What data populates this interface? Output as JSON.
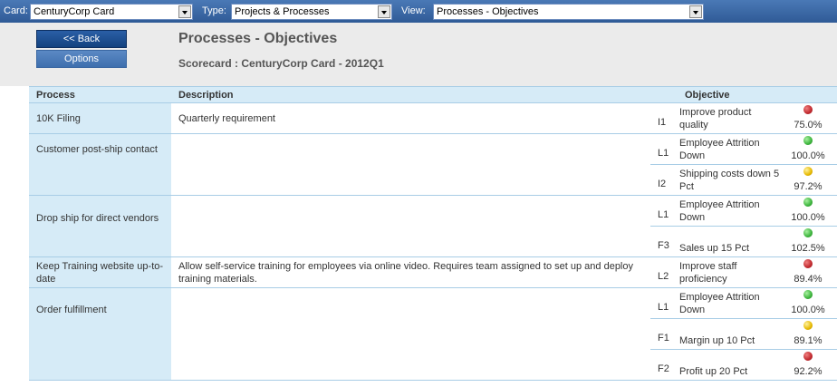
{
  "toolbar": {
    "card_label": "Card:",
    "card_value": "CenturyCorp Card",
    "type_label": "Type:",
    "type_value": "Projects & Processes",
    "view_label": "View:",
    "view_value": "Processes - Objectives"
  },
  "header": {
    "back_label": "<< Back",
    "options_label": "Options",
    "title": "Processes - Objectives",
    "subtitle": "Scorecard : CenturyCorp Card - 2012Q1"
  },
  "table": {
    "columns": {
      "process": "Process",
      "description": "Description",
      "objective": "Objective"
    },
    "rows": [
      {
        "process": "10K Filing",
        "description": "Quarterly requirement",
        "objectives": [
          {
            "code": "I1",
            "name": "Improve product quality",
            "status": "red",
            "value": "75.0%"
          }
        ]
      },
      {
        "process": "Customer post-ship contact",
        "description": "",
        "objectives": [
          {
            "code": "L1",
            "name": "Employee Attrition Down",
            "status": "green",
            "value": "100.0%"
          },
          {
            "code": "I2",
            "name": "Shipping costs down 5 Pct",
            "status": "yellow",
            "value": "97.2%"
          }
        ]
      },
      {
        "process": "Drop ship for direct vendors",
        "description": "",
        "objectives": [
          {
            "code": "L1",
            "name": "Employee Attrition Down",
            "status": "green",
            "value": "100.0%"
          },
          {
            "code": "F3",
            "name": "Sales up 15 Pct",
            "status": "green",
            "value": "102.5%"
          }
        ]
      },
      {
        "process": "Keep Training website up-to-date",
        "description": "Allow self-service training for employees via online video. Requires team assigned to set up and deploy training materials.",
        "objectives": [
          {
            "code": "L2",
            "name": "Improve staff proficiency",
            "status": "red",
            "value": "89.4%"
          }
        ]
      },
      {
        "process": "Order fulfillment",
        "description": "",
        "objectives": [
          {
            "code": "L1",
            "name": "Employee Attrition Down",
            "status": "green",
            "value": "100.0%"
          },
          {
            "code": "F1",
            "name": "Margin up 10 Pct",
            "status": "yellow",
            "value": "89.1%"
          },
          {
            "code": "F2",
            "name": "Profit up 20 Pct",
            "status": "red",
            "value": "92.2%"
          }
        ]
      }
    ]
  }
}
